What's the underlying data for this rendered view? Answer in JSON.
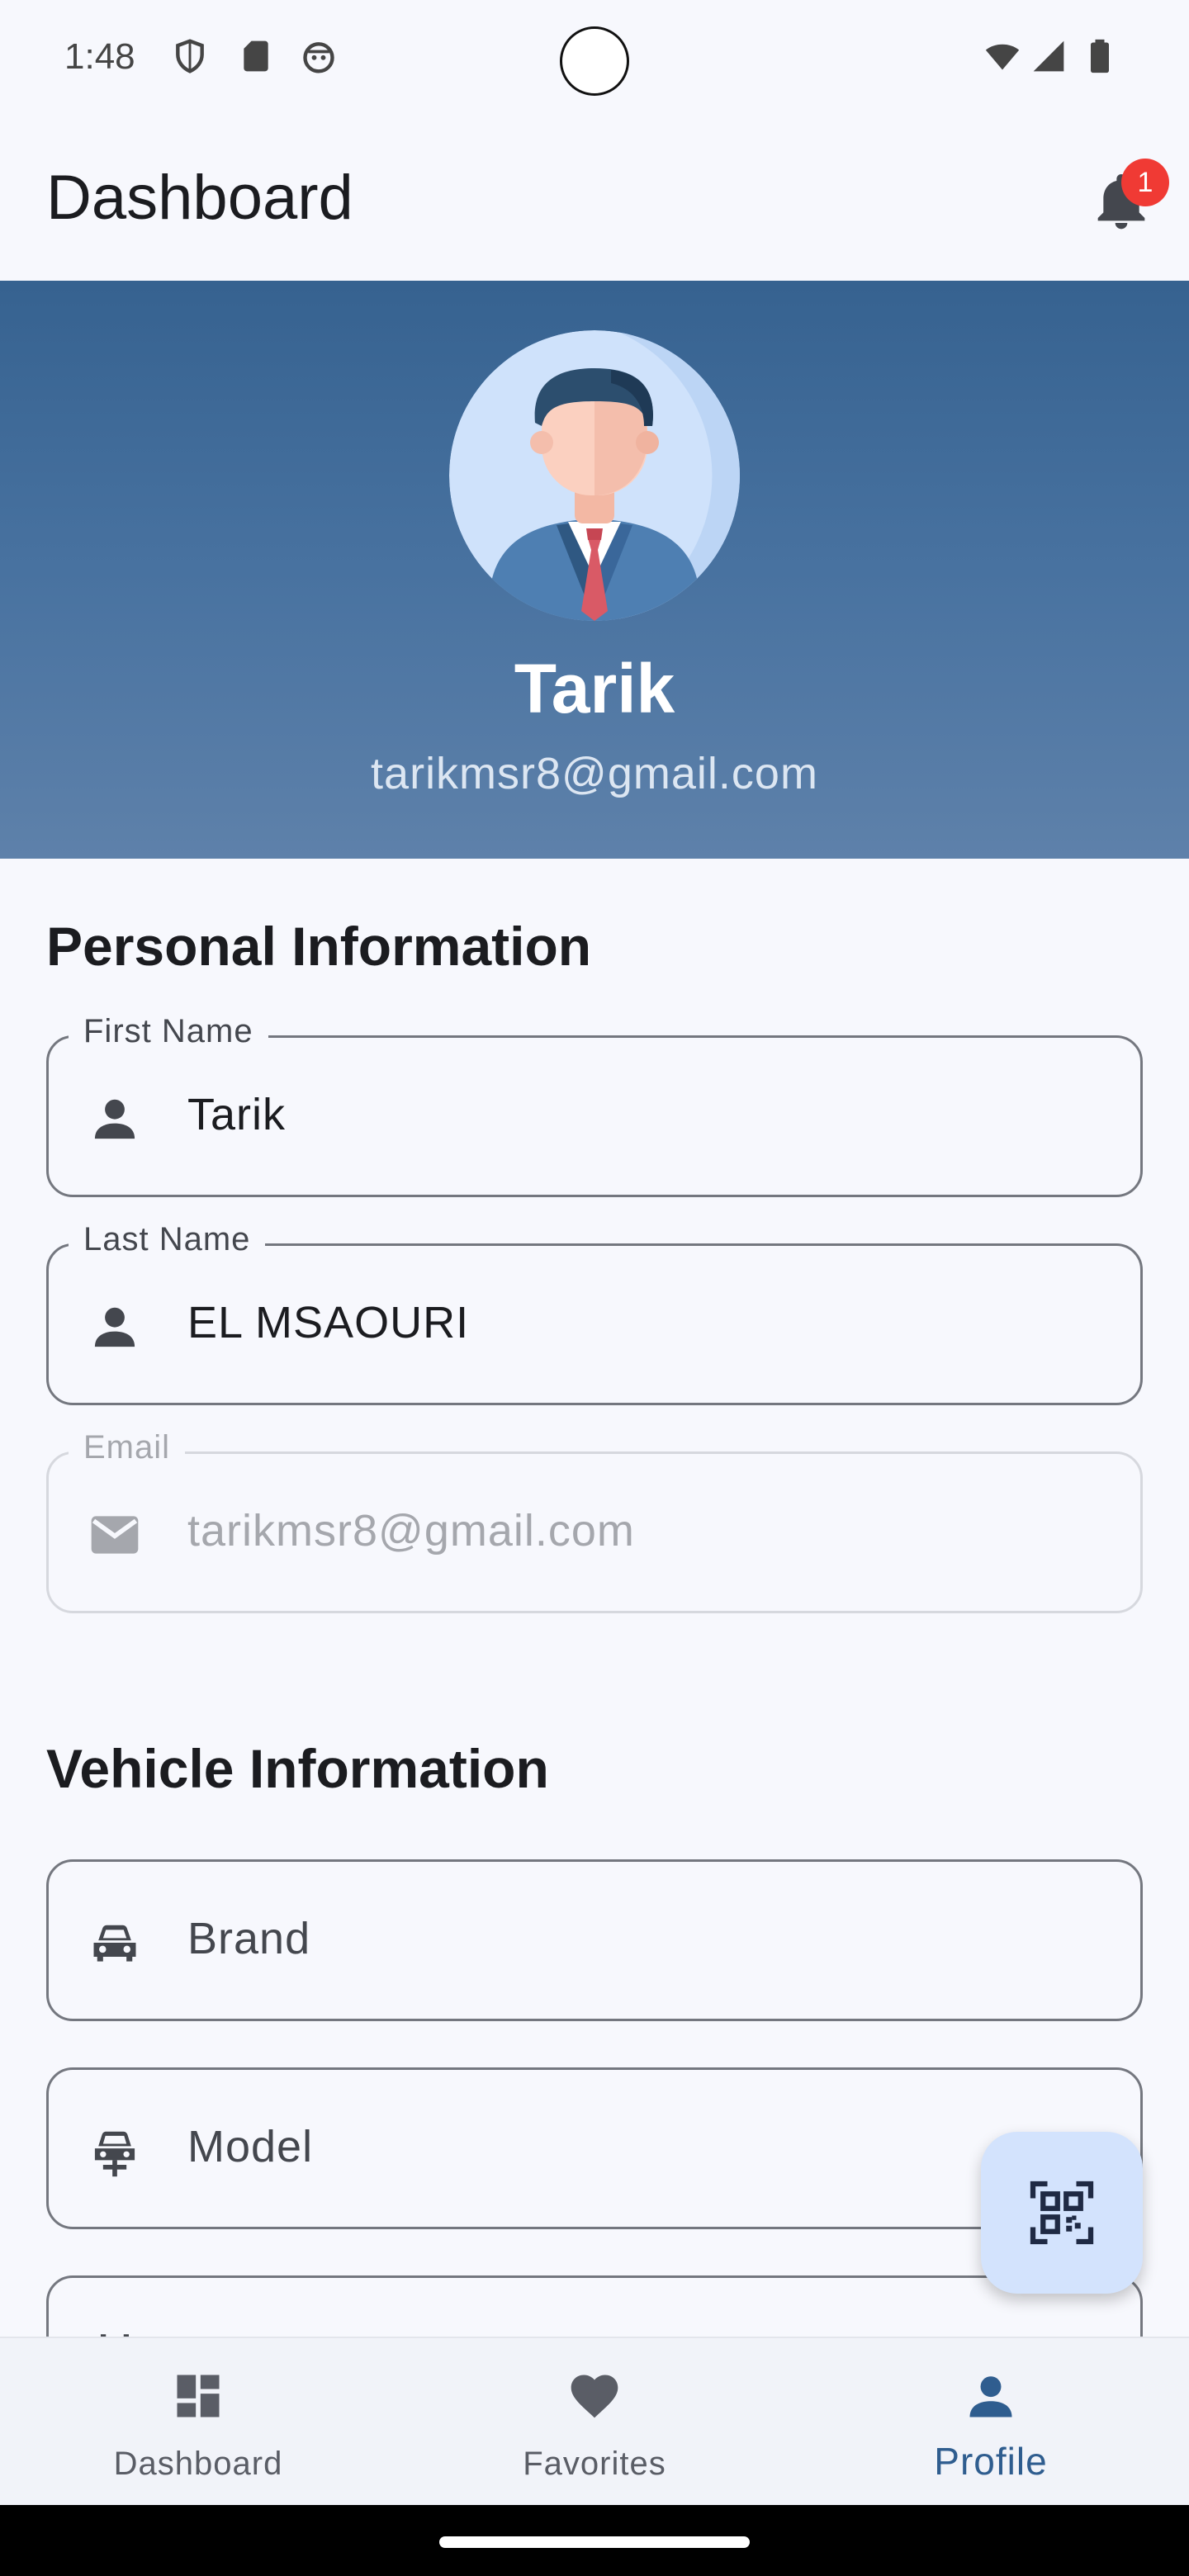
{
  "status_bar": {
    "time": "1:48",
    "left_icons": [
      "shield-icon",
      "sd-card-icon",
      "android-face-icon"
    ],
    "right_icons": [
      "wifi-icon",
      "signal-icon",
      "battery-icon"
    ]
  },
  "app_bar": {
    "title": "Dashboard",
    "notification_count": "1"
  },
  "profile": {
    "name": "Tarik",
    "email": "tarikmsr8@gmail.com"
  },
  "personal": {
    "title": "Personal Information",
    "first_name_label": "First Name",
    "first_name_value": "Tarik",
    "last_name_label": "Last Name",
    "last_name_value": "EL MSAOURI",
    "email_label": "Email",
    "email_value": "tarikmsr8@gmail.com"
  },
  "vehicle": {
    "title": "Vehicle Information",
    "brand_placeholder": "Brand",
    "model_placeholder": "Model",
    "year_placeholder": "Y"
  },
  "fab": {
    "icon": "qr-scan-icon"
  },
  "bottom_nav": {
    "items": [
      {
        "label": "Dashboard",
        "icon": "dashboard-icon"
      },
      {
        "label": "Favorites",
        "icon": "heart-icon"
      },
      {
        "label": "Profile",
        "icon": "person-icon"
      }
    ],
    "active_index": 2
  },
  "colors": {
    "header_gradient_top": "#366290",
    "header_gradient_bottom": "#5e81aa",
    "accent": "#2f5d8f",
    "badge": "#f03a34",
    "fab_bg": "#d3e3fd"
  }
}
